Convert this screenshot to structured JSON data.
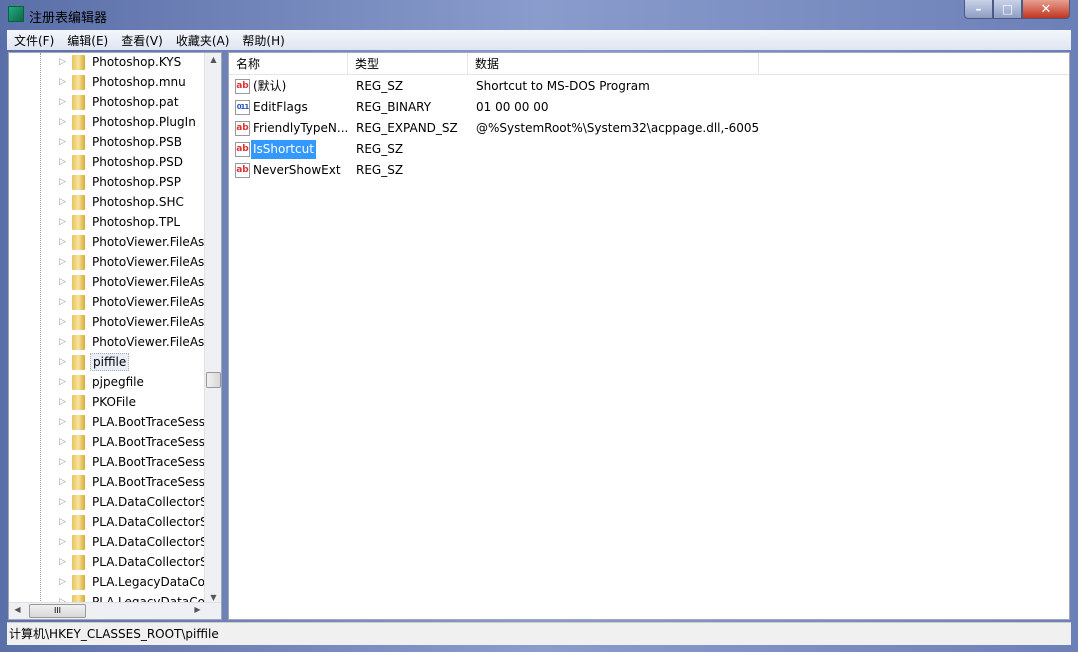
{
  "window": {
    "title": "注册表编辑器",
    "minimize": "–",
    "maximize": "□",
    "close": "✕"
  },
  "menu": [
    "文件(F)",
    "编辑(E)",
    "查看(V)",
    "收藏夹(A)",
    "帮助(H)"
  ],
  "tree": {
    "items": [
      "Photoshop.KYS",
      "Photoshop.mnu",
      "Photoshop.pat",
      "Photoshop.PlugIn",
      "Photoshop.PSB",
      "Photoshop.PSD",
      "Photoshop.PSP",
      "Photoshop.SHC",
      "Photoshop.TPL",
      "PhotoViewer.FileAss",
      "PhotoViewer.FileAss",
      "PhotoViewer.FileAss",
      "PhotoViewer.FileAss",
      "PhotoViewer.FileAss",
      "PhotoViewer.FileAss",
      "piffile",
      "pjpegfile",
      "PKOFile",
      "PLA.BootTraceSessi",
      "PLA.BootTraceSessi",
      "PLA.BootTraceSessi",
      "PLA.BootTraceSessi",
      "PLA.DataCollectorSe",
      "PLA.DataCollectorSe",
      "PLA.DataCollectorSe",
      "PLA.DataCollectorSe",
      "PLA.LegacyDataColl",
      "PLA.LegacyDataColl"
    ],
    "selected": "piffile",
    "hscroll_grip": "III"
  },
  "list": {
    "columns": [
      "名称",
      "类型",
      "数据"
    ],
    "rows": [
      {
        "name": "(默认)",
        "type": "REG_SZ",
        "data": "Shortcut to MS-DOS Program",
        "icon": "ab"
      },
      {
        "name": "EditFlags",
        "type": "REG_BINARY",
        "data": "01 00 00 00",
        "icon": "011"
      },
      {
        "name": "FriendlyTypeN...",
        "type": "REG_EXPAND_SZ",
        "data": "@%SystemRoot%\\System32\\acppage.dll,-6005",
        "icon": "ab"
      },
      {
        "name": "IsShortcut",
        "type": "REG_SZ",
        "data": "",
        "icon": "ab"
      },
      {
        "name": "NeverShowExt",
        "type": "REG_SZ",
        "data": "",
        "icon": "ab"
      }
    ],
    "selected": "IsShortcut"
  },
  "status": "计算机\\HKEY_CLASSES_ROOT\\piffile"
}
